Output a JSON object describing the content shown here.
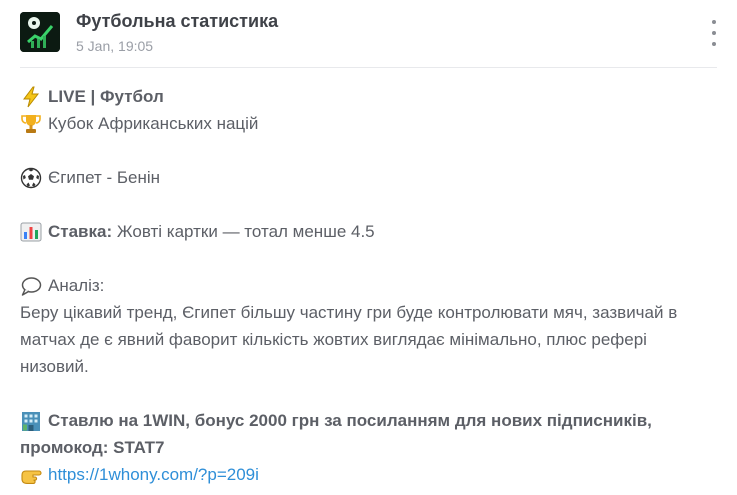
{
  "header": {
    "channel_title": "Футбольна статистика",
    "post_date": "5 Jan, 19:05",
    "avatar_icon": "soccer-chart-icon",
    "more_icon": "more-vertical-icon"
  },
  "post": {
    "line1_bold": "LIVE | Футбол",
    "line2": "Кубок Африканських націй",
    "match": "Єгипет - Бенін",
    "bet_label": "Ставка:",
    "bet_value": "Жовті картки — тотал менше 4.5",
    "analysis_label": "Аналіз:",
    "analysis_text": "Беру цікавий тренд, Єгипет більшу частину гри буде контролювати мяч, зазвичай в матчах де є явний фаворит кількість жовтих виглядає мінімально, плюс рефері низовий.",
    "promo_line1": "Ставлю на 1WIN, бонус 2000 грн за посиланням для нових підписників,",
    "promo_line2": "промокод: STAT7",
    "link_text": "https://1whony.com/?p=209i"
  },
  "icons": [
    "lightning-icon",
    "trophy-icon",
    "soccer-ball-icon",
    "bar-chart-icon",
    "speech-bubble-icon",
    "building-icon",
    "pointing-hand-icon"
  ],
  "colors": {
    "link": "#2f8fd8",
    "text": "#5c5f66",
    "title": "#3f4248"
  }
}
